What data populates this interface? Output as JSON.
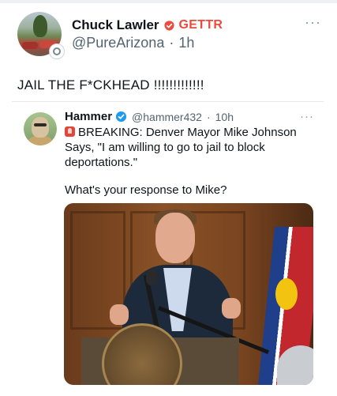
{
  "post": {
    "author_name": "Chuck Lawler",
    "platform_badge": "GETTR",
    "handle": "@PureArizona",
    "separator": "·",
    "time": "1h",
    "text": "JAIL THE F*CKHEAD !!!!!!!!!!!!!"
  },
  "quote": {
    "author_name": "Hammer",
    "handle": "@hammer432",
    "separator": "·",
    "time": "10h",
    "text_line": "BREAKING: Denver Mayor Mike Johnson Says, \"I am willing to go to jail to block deportations.\"",
    "question": "What's your response to Mike?"
  },
  "icons": {
    "more": "more-horizontal-icon",
    "gettr": "gettr-logo-icon",
    "verified": "verified-badge-icon",
    "siren": "rotating-light-icon"
  },
  "colors": {
    "gettr_red": "#ec4a3d",
    "verified_blue": "#1d9bf0",
    "secondary_text": "#536471"
  }
}
